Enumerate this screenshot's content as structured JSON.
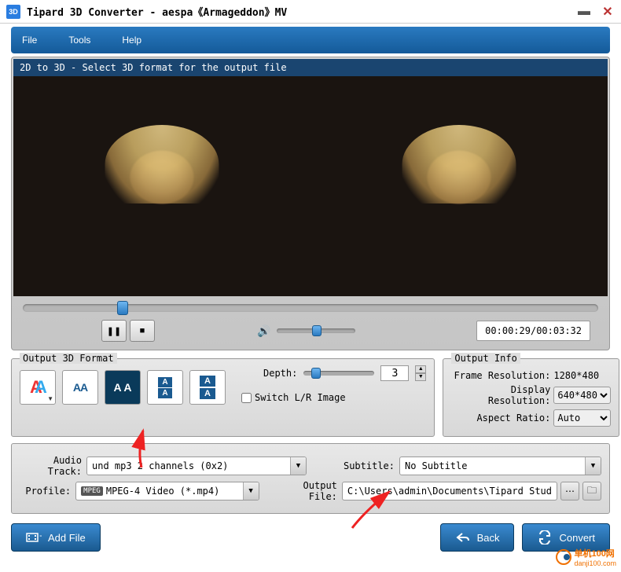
{
  "window": {
    "title": "Tipard 3D Converter - aespa《Armageddon》MV"
  },
  "menu": {
    "file": "File",
    "tools": "Tools",
    "help": "Help"
  },
  "preview": {
    "header": "2D to 3D - Select 3D format for the output file",
    "time": "00:00:29/00:03:32"
  },
  "format": {
    "fieldset": "Output 3D Format",
    "depth_label": "Depth:",
    "depth_value": "3",
    "switch_label": "Switch L/R Image"
  },
  "info": {
    "fieldset": "Output Info",
    "frame_res_label": "Frame Resolution:",
    "frame_res_value": "1280*480",
    "disp_res_label": "Display Resolution:",
    "disp_res_value": "640*480",
    "aspect_label": "Aspect Ratio:",
    "aspect_value": "Auto"
  },
  "tracks": {
    "audio_label": "Audio Track:",
    "audio_value": "und mp3 2 channels (0x2)",
    "profile_label": "Profile:",
    "profile_value": "MPEG-4 Video (*.mp4)",
    "subtitle_label": "Subtitle:",
    "subtitle_value": "No Subtitle",
    "output_label": "Output File:",
    "output_value": "C:\\Users\\admin\\Documents\\Tipard Stud"
  },
  "buttons": {
    "add": "Add File",
    "back": "Back",
    "convert": "Convert"
  },
  "watermark": {
    "text": "单机100网",
    "url": "danji100.com"
  }
}
